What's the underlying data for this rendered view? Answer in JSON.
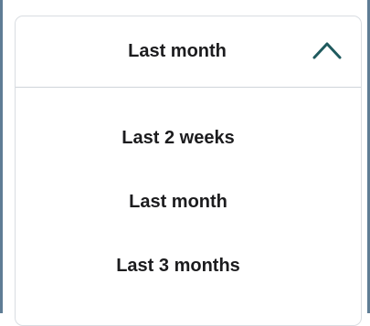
{
  "dropdown": {
    "selected_label": "Last month",
    "expanded": true,
    "toggle_icon": "chevron-up-icon",
    "accent_color": "#1f5a5e",
    "options": [
      {
        "label": "Last 2 weeks"
      },
      {
        "label": "Last month"
      },
      {
        "label": "Last 3 months"
      }
    ]
  }
}
